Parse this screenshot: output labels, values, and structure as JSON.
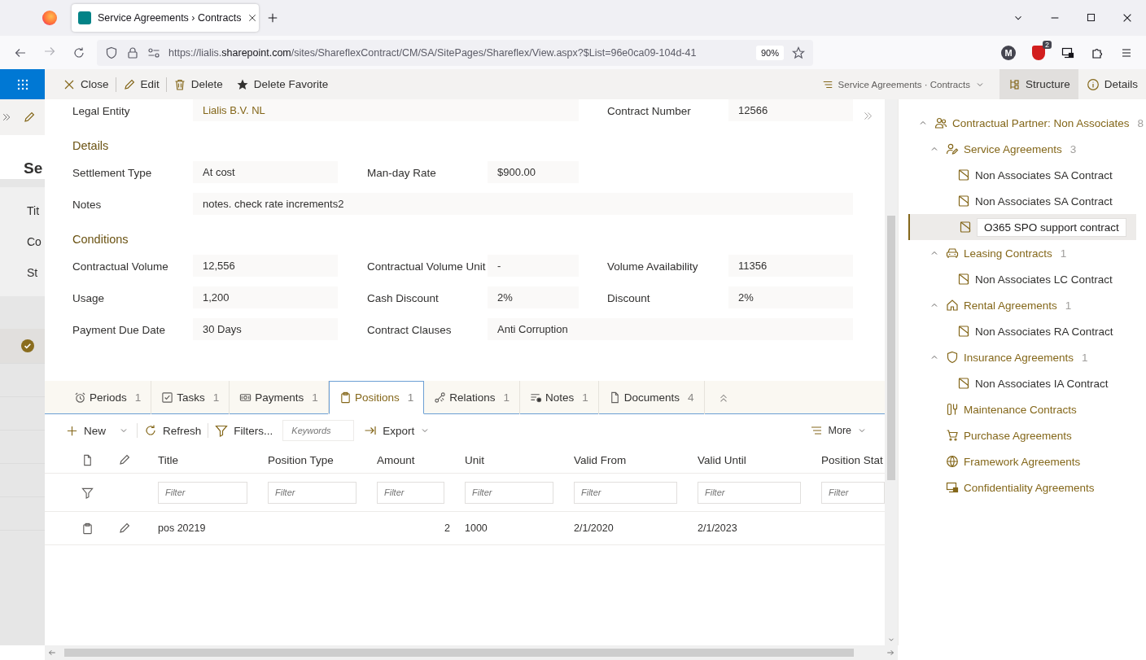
{
  "browser": {
    "tab_title": "Service Agreements › Contracts",
    "url_prefix": "https://lialis.",
    "url_host": "sharepoint.com",
    "url_path": "/sites/ShareflexContract/CM/SA/SitePages/Shareflex/View.aspx?$List=96e0ca09-104d-41",
    "zoom": "90%",
    "profile_initial": "M",
    "extension_badge": "2"
  },
  "command_bar": {
    "actions": [
      {
        "label": "Close"
      },
      {
        "label": "Edit"
      },
      {
        "label": "Delete"
      },
      {
        "label": "Delete Favorite"
      }
    ],
    "breadcrumb": "Service Agreements · Contracts",
    "panel_tabs": [
      {
        "label": "Structure",
        "selected": true
      },
      {
        "label": "Details",
        "selected": false
      }
    ]
  },
  "background_page": {
    "title": "Se",
    "labels": [
      "Tit",
      "Co",
      "St"
    ]
  },
  "form": {
    "sections": [
      {
        "rows": [
          [
            {
              "label": "Legal Entity",
              "value": "Lialis B.V. NL",
              "kind": "wide",
              "link": true
            },
            {
              "label": "Contract Number",
              "value": "12566",
              "kind": "short",
              "link": false
            }
          ]
        ]
      },
      {
        "title": "Details",
        "rows": [
          [
            {
              "label": "Settlement Type",
              "value": "At cost",
              "kind": "short",
              "link": false
            },
            {
              "label": "Man-day Rate",
              "value": "$900.00",
              "kind": "short",
              "link": false
            }
          ],
          [
            {
              "label": "Notes",
              "value": "notes. check rate increments2",
              "kind": "wide",
              "link": false
            }
          ]
        ]
      },
      {
        "title": "Conditions",
        "rows": [
          [
            {
              "label": "Contractual Volume",
              "value": "12,556",
              "kind": "short",
              "link": false
            },
            {
              "label": "Contractual Volume Unit",
              "value": "-",
              "kind": "short",
              "link": false
            },
            {
              "label": "Volume Availability",
              "value": "11356",
              "kind": "short",
              "link": false
            }
          ],
          [
            {
              "label": "Usage",
              "value": "1,200",
              "kind": "short",
              "link": false
            },
            {
              "label": "Cash Discount",
              "value": "2%",
              "kind": "short",
              "link": false
            },
            {
              "label": "Discount",
              "value": "2%",
              "kind": "short",
              "link": false
            }
          ],
          [
            {
              "label": "Payment Due Date",
              "value": "30 Days",
              "kind": "short",
              "link": false
            },
            {
              "label": "Contract Clauses",
              "value": "Anti Corruption",
              "kind": "wide",
              "link": false
            }
          ]
        ]
      }
    ]
  },
  "tabs": [
    {
      "label": "Periods",
      "count": "1",
      "selected": false
    },
    {
      "label": "Tasks",
      "count": "1",
      "selected": false
    },
    {
      "label": "Payments",
      "count": "1",
      "selected": false
    },
    {
      "label": "Positions",
      "count": "1",
      "selected": true
    },
    {
      "label": "Relations",
      "count": "1",
      "selected": false
    },
    {
      "label": "Notes",
      "count": "1",
      "selected": false
    },
    {
      "label": "Documents",
      "count": "4",
      "selected": false
    }
  ],
  "toolbar": {
    "new": "New",
    "refresh": "Refresh",
    "filters": "Filters...",
    "keywords_placeholder": "Keywords",
    "export": "Export",
    "more": "More"
  },
  "table": {
    "columns": [
      "Title",
      "Position Type",
      "Amount",
      "Unit",
      "Valid From",
      "Valid Until",
      "Position Stat"
    ],
    "filters": [
      {
        "placeholder": "Filter"
      },
      {
        "placeholder": "Filter"
      },
      {
        "placeholder": "Filter"
      },
      {
        "placeholder": "Filter"
      },
      {
        "placeholder": "Filter"
      },
      {
        "placeholder": "Filter"
      },
      {
        "placeholder": "Filter"
      }
    ],
    "rows": [
      {
        "title": "pos 20219",
        "amount": "2",
        "unit": "1000",
        "valid_from": "2/1/2020",
        "valid_until": "2/1/2023"
      }
    ]
  },
  "tree": [
    {
      "label": "Contractual Partner: Non Associates",
      "count": "8",
      "kind": "partner",
      "expanded": true,
      "selected": false,
      "children": [
        {
          "label": "Service Agreements",
          "count": "3",
          "kind": "category",
          "expanded": true,
          "selected": false,
          "children": [
            {
              "label": "Non Associates SA Contract",
              "kind": "contract",
              "selected": false
            },
            {
              "label": "Non Associates SA Contract",
              "kind": "contract",
              "selected": false
            },
            {
              "label": "O365 SPO support contract",
              "kind": "contract",
              "selected": true
            }
          ]
        },
        {
          "label": "Leasing Contracts",
          "count": "1",
          "kind": "category",
          "expanded": true,
          "selected": false,
          "children": [
            {
              "label": "Non Associates LC Contract",
              "kind": "contract",
              "selected": false
            }
          ]
        },
        {
          "label": "Rental Agreements",
          "count": "1",
          "kind": "category",
          "expanded": true,
          "selected": false,
          "children": [
            {
              "label": "Non Associates RA Contract",
              "kind": "contract",
              "selected": false
            }
          ]
        },
        {
          "label": "Insurance Agreements",
          "count": "1",
          "kind": "category",
          "expanded": true,
          "selected": false,
          "children": [
            {
              "label": "Non Associates IA Contract",
              "kind": "contract",
              "selected": false
            }
          ]
        },
        {
          "label": "Maintenance Contracts",
          "kind": "category",
          "selected": false
        },
        {
          "label": "Purchase Agreements",
          "kind": "category",
          "selected": false
        },
        {
          "label": "Framework Agreements",
          "kind": "category",
          "selected": false
        },
        {
          "label": "Confidentiality Agreements",
          "kind": "category",
          "selected": false
        }
      ]
    }
  ]
}
